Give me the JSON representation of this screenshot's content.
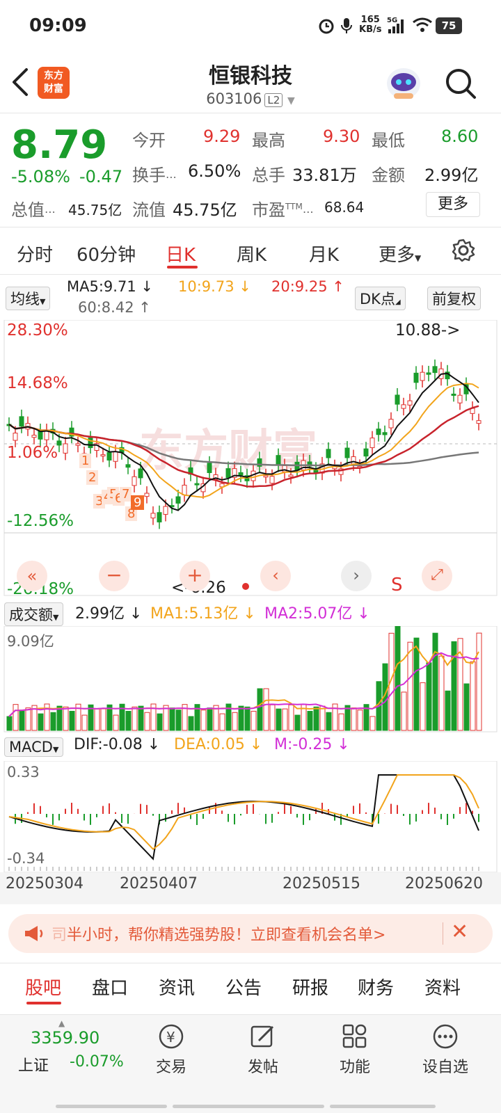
{
  "status_bar": {
    "time": "09:09",
    "net_speed_top": "165",
    "net_speed_unit": "KB/s",
    "network": "5G",
    "battery": "75"
  },
  "header": {
    "title": "恒银科技",
    "code": "603106",
    "level": "L2",
    "logo_text_line1": "东方",
    "logo_text_line2": "财富"
  },
  "quote": {
    "price": "8.79",
    "change_pct": "-5.08%",
    "change": "-0.47",
    "open_label": "今开",
    "open": "9.29",
    "high_label": "最高",
    "high": "9.30",
    "low_label": "最低",
    "low": "8.60",
    "turnover_label": "换手",
    "turnover": "6.50%",
    "volume_label": "总手",
    "volume": "33.81万",
    "amount_label": "金额",
    "amount": "2.99亿",
    "mktcap_label": "总值",
    "mktcap": "45.75亿",
    "float_label": "流值",
    "float": "45.75亿",
    "pe_label": "市盈",
    "pe_sup": "TTM",
    "pe": "68.64",
    "more_button": "更多"
  },
  "period_tabs": [
    "分时",
    "60分钟",
    "日K",
    "周K",
    "月K",
    "更多"
  ],
  "active_tab_index": 2,
  "ma_bar": {
    "selector": "均线",
    "ma5": "MA5:9.71",
    "ma10": "10:9.73",
    "ma20": "20:9.25",
    "ma60": "60:8.42",
    "dk_button": "DK点",
    "fq_button": "前复权"
  },
  "kline": {
    "pct_labels": [
      "28.30%",
      "14.68%",
      "1.06%",
      "-12.56%",
      "-26.18%"
    ],
    "max_label": "10.88->",
    "min_label": "<-6.26",
    "s_label": "S",
    "nine_turn": [
      "1",
      "2",
      "3",
      "4",
      "5",
      "6",
      "7",
      "8",
      "9"
    ]
  },
  "volume_panel": {
    "selector": "成交额",
    "value": "2.99亿",
    "ma1": "MA1:5.13亿",
    "ma2": "MA2:5.07亿",
    "max_label": "9.09亿"
  },
  "macd_panel": {
    "selector": "MACD",
    "dif": "DIF:-0.08",
    "dea": "DEA:0.05",
    "m": "M:-0.25",
    "top_label": "0.33",
    "bottom_label": "-0.34"
  },
  "dates": [
    "20250304",
    "20250407",
    "20250515",
    "20250620"
  ],
  "banner": {
    "text_prefix": "司",
    "text": "半小时，帮你精选强势股！立即查看机会名单>"
  },
  "info_tabs": [
    "股吧",
    "盘口",
    "资讯",
    "公告",
    "研报",
    "财务",
    "资料"
  ],
  "bottom_bar": {
    "index_value": "3359.90",
    "index_name": "上证",
    "index_change": "-0.07%",
    "items": [
      "交易",
      "发帖",
      "功能",
      "设自选"
    ]
  },
  "colors": {
    "up": "#e0312e",
    "down": "#1a9c2b",
    "ma10": "#f2a41b",
    "ma60": "#777777",
    "brand": "#f15a22"
  }
}
